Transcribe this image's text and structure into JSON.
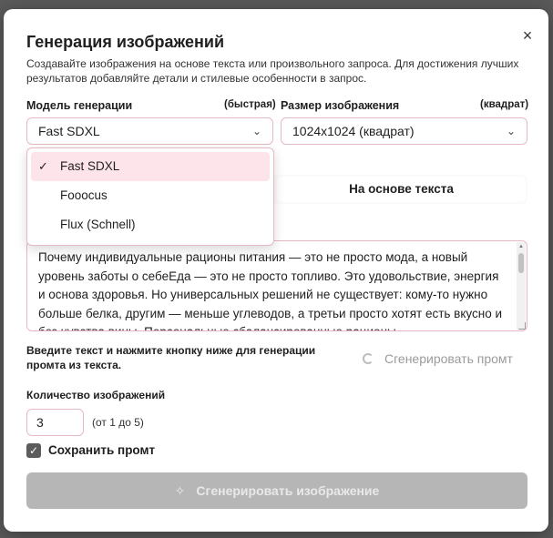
{
  "dialog": {
    "title": "Генерация изображений",
    "subtitle": "Создавайте изображения на основе текста или произвольного запроса. Для достижения лучших результатов добавляйте детали и стилевые особенности в запрос.",
    "close_icon": "×"
  },
  "model": {
    "label": "Модель генерации",
    "hint": "(быстрая)",
    "value": "Fast SDXL",
    "options": [
      "Fast SDXL",
      "Fooocus",
      "Flux (Schnell)"
    ],
    "selected_index": 0
  },
  "size": {
    "label": "Размер изображения",
    "hint": "(квадрат)",
    "value": "1024x1024 (квадрат)"
  },
  "tabs": {
    "active_label": "На основе текста"
  },
  "text_input": {
    "value": "Почему индивидуальные рационы питания — это не просто мода, а новый уровень заботы о себеЕда — это не просто топливо. Это удовольствие, энергия и основа здоровья. Но универсальных решений не существует: кому-то нужно больше белка, другим — меньше углеводов, а третьи просто хотят есть вкусно и без чувства вины. Персональные сбалансированные рационы"
  },
  "prompt_generation": {
    "instruction": "Введите текст и нажмите кнопку ниже для генерации промта из текста.",
    "button_label": "Сгенерировать промт"
  },
  "count": {
    "label": "Количество изображений",
    "value": "3",
    "hint": "(от 1 до 5)"
  },
  "save_prompt": {
    "label": "Сохранить промт",
    "checked": true
  },
  "generate_button": {
    "label": "Сгенерировать изображение",
    "icon": "sparkle-icon"
  },
  "colors": {
    "accent_border": "#e7b9c2",
    "selected_item_bg": "#fde4ea",
    "disabled_button_bg": "#b6b6b6"
  }
}
